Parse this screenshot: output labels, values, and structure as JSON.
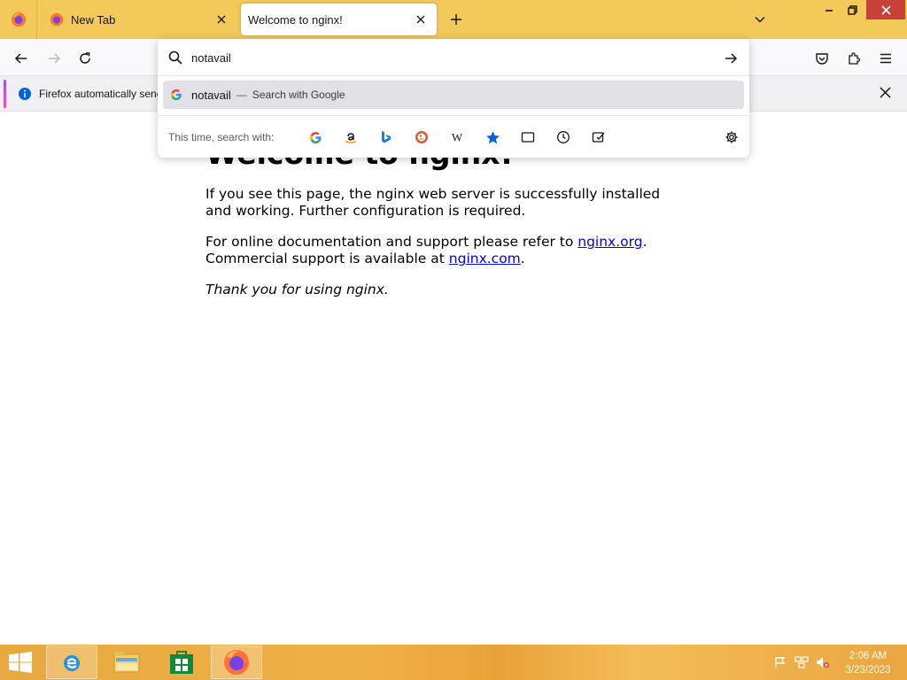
{
  "tabs": [
    {
      "title": "New Tab",
      "active": false
    },
    {
      "title": "Welcome to nginx!",
      "active": true
    }
  ],
  "urlbar": {
    "value": "notavail",
    "suggestion": {
      "query": "notavail",
      "separator": "—",
      "engine_text": "Search with Google"
    },
    "oneoff_label": "This time, search with:",
    "engines": [
      "google-icon",
      "amazon-icon",
      "bing-icon",
      "duckduckgo-icon",
      "wikipedia-icon",
      "bookmarks-icon",
      "tabs-icon",
      "history-icon",
      "actions-icon"
    ]
  },
  "notification": {
    "text": "Firefox automatically sends"
  },
  "page": {
    "heading": "Welcome to nginx!",
    "p1": "If you see this page, the nginx web server is successfully installed and working. Further configuration is required.",
    "p2_before": "For online documentation and support please refer to ",
    "p2_link1": "nginx.org",
    "p2_mid": ". Commercial support is available at ",
    "p2_link2": "nginx.com",
    "p2_after": ".",
    "p3": "Thank you for using nginx."
  },
  "taskbar": {
    "time": "2:06 AM",
    "date": "3/23/2023"
  },
  "colors": {
    "tabstrip": "#f3c95a",
    "accent": "#0061e0",
    "taskbar": "#eea745"
  }
}
